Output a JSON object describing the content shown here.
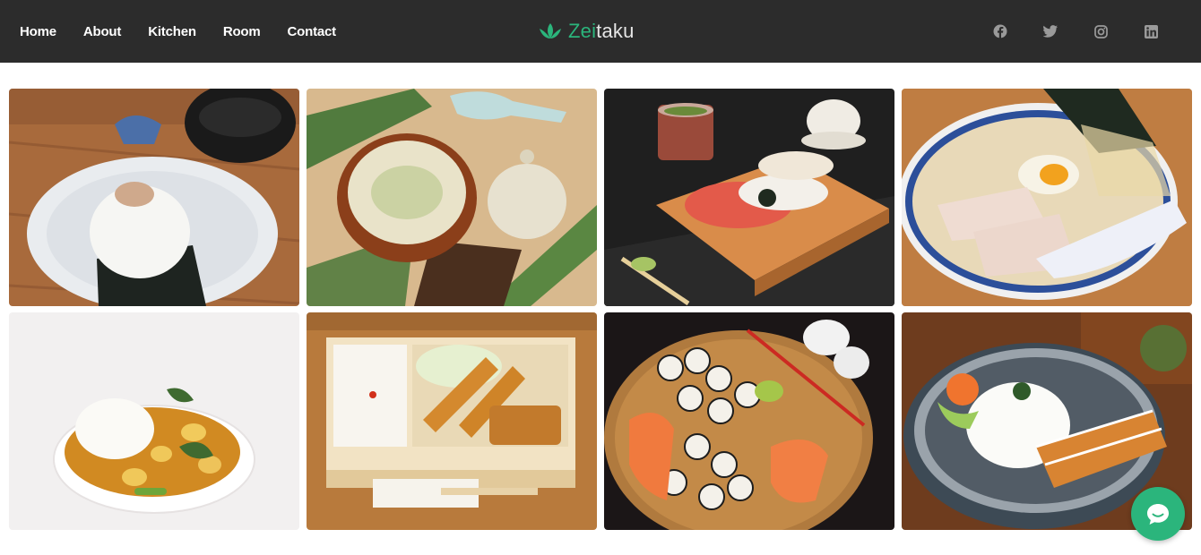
{
  "nav": {
    "links": [
      {
        "label": "Home"
      },
      {
        "label": "About"
      },
      {
        "label": "Kitchen"
      },
      {
        "label": "Room"
      },
      {
        "label": "Contact"
      }
    ]
  },
  "brand": {
    "accent_text": "Zei",
    "rest_text": "taku",
    "accent_color": "#2bb57c",
    "icon": "lotus-icon"
  },
  "socials": [
    {
      "icon": "facebook-icon"
    },
    {
      "icon": "twitter-icon"
    },
    {
      "icon": "instagram-icon"
    },
    {
      "icon": "linkedin-icon"
    }
  ],
  "gallery": {
    "images": [
      {
        "subject": "onigiri-rice-ball-with-miso-soup"
      },
      {
        "subject": "miso-soup-with-teapot"
      },
      {
        "subject": "sushi-platter-on-wooden-board"
      },
      {
        "subject": "ramen-bowl-with-egg"
      },
      {
        "subject": "japanese-curry-rice"
      },
      {
        "subject": "bento-box-with-fried-shrimp"
      },
      {
        "subject": "sushi-roll-platter"
      },
      {
        "subject": "rice-bowl-with-fried-shrimp"
      }
    ]
  },
  "chat": {
    "icon": "chat-bubble-icon",
    "color": "#2bb57c"
  }
}
